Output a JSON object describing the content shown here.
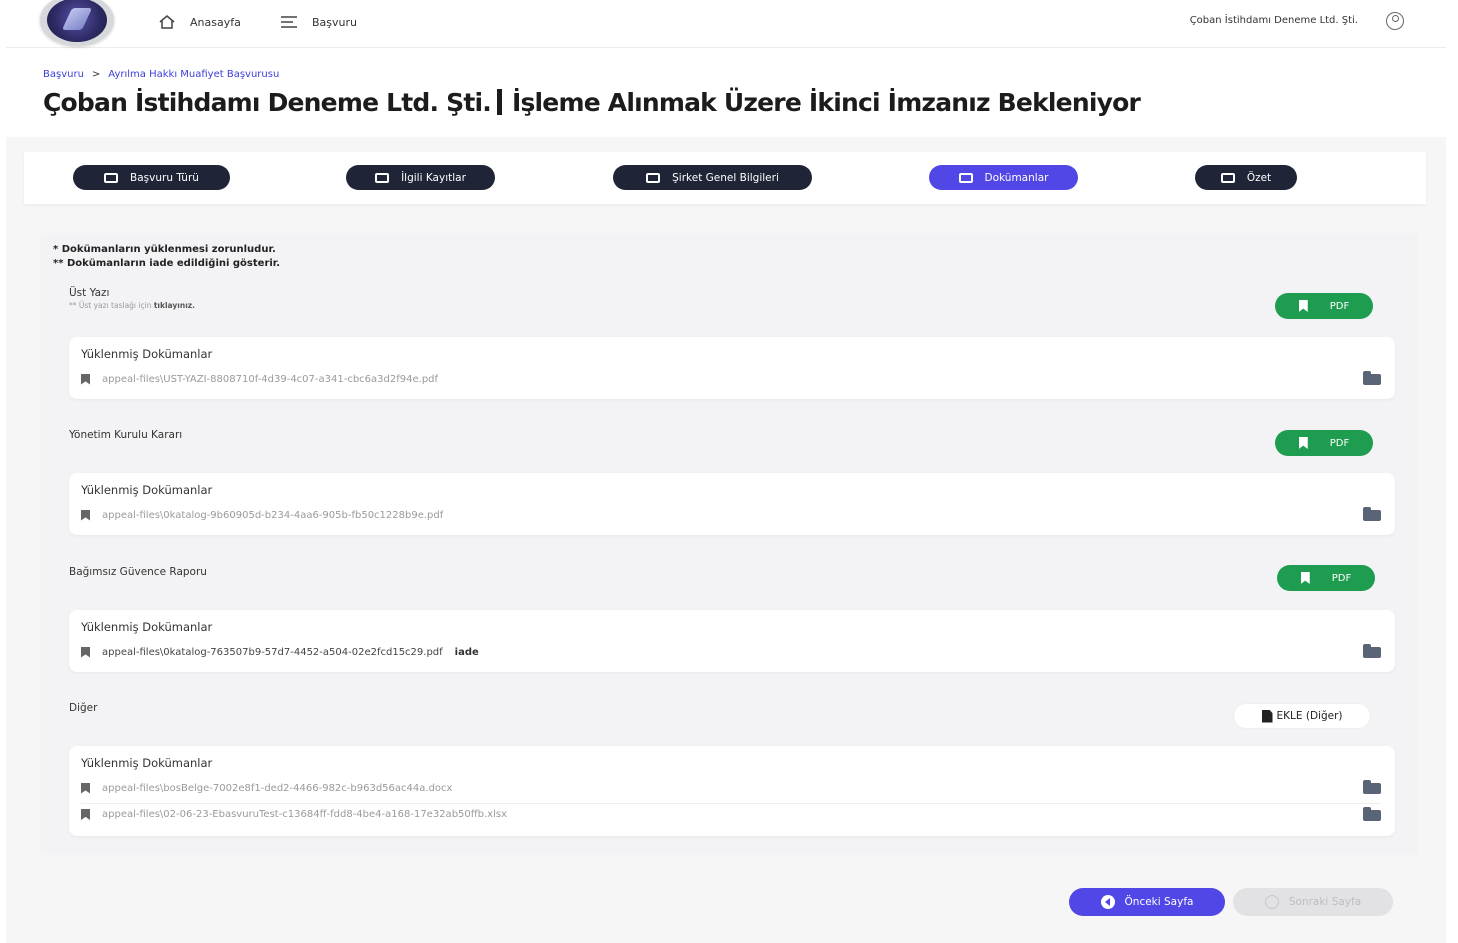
{
  "nav": {
    "home_label": "Anasayfa",
    "home_icon": "home-icon",
    "apply_label": "Başvuru",
    "apply_icon": "menu-icon",
    "company": "Çoban İstihdamı Deneme Ltd. Şti.",
    "user_icon": "user-circle-icon"
  },
  "breadcrumb": {
    "root": "Başvuru",
    "separator": ">",
    "current": "Ayrılma Hakkı Muafiyet Başvurusu"
  },
  "title": {
    "company": "Çoban İstihdamı Deneme Ltd. Şti.",
    "status": "İşleme Alınmak Üzere İkinci İmzanız Bekleniyor"
  },
  "steps": [
    {
      "label": "Başvuru Türü",
      "active": false
    },
    {
      "label": "İlgili Kayıtlar",
      "active": false
    },
    {
      "label": "Şirket Genel Bilgileri",
      "active": false
    },
    {
      "label": "Dokümanlar",
      "active": true
    },
    {
      "label": "Özet",
      "active": false
    }
  ],
  "notes": {
    "required": "*  Dokümanların yüklenmesi zorunludur.",
    "returned": "** Dokümanların iade edildiğini gösterir."
  },
  "uploaded_label": "Yüklenmiş Dokümanlar",
  "sections": [
    {
      "title": "Üst Yazı",
      "subtitle_prefix": "** Üst yazı taslağı için",
      "subtitle_link": "tıklayınız.",
      "button": "PDF",
      "files": [
        {
          "name": "appeal-files\\UST-YAZI-8808710f-4d39-4c07-a341-cbc6a3d2f94e.pdf",
          "iade": ""
        }
      ]
    },
    {
      "title": "Yönetim Kurulu Kararı",
      "button": "PDF",
      "files": [
        {
          "name": "appeal-files\\0katalog-9b60905d-b234-4aa6-905b-fb50c1228b9e.pdf",
          "iade": ""
        }
      ]
    },
    {
      "title": "Bağımsız Güvence Raporu",
      "button": "PDF",
      "files": [
        {
          "name": "appeal-files\\0katalog-763507b9-57d7-4452-a504-02e2fcd15c29.pdf",
          "iade": "iade"
        }
      ]
    },
    {
      "title": "Diğer",
      "button": "EKLE (Diğer)",
      "files": [
        {
          "name": "appeal-files\\bosBelge-7002e8f1-ded2-4466-982c-b963d56ac44a.docx",
          "iade": ""
        },
        {
          "name": "appeal-files\\02-06-23-EbasvuruTest-c13684ff-fdd8-4be4-a168-17e32ab50ffb.xlsx",
          "iade": ""
        }
      ]
    }
  ],
  "footer": {
    "prev": "Önceki Sayfa",
    "next": "Sonraki Sayfa"
  },
  "colors": {
    "accent": "#5146e6",
    "step_dark": "#1f2436",
    "pdf_green": "#1e9c4f",
    "link_blue": "#3a3fd6"
  }
}
